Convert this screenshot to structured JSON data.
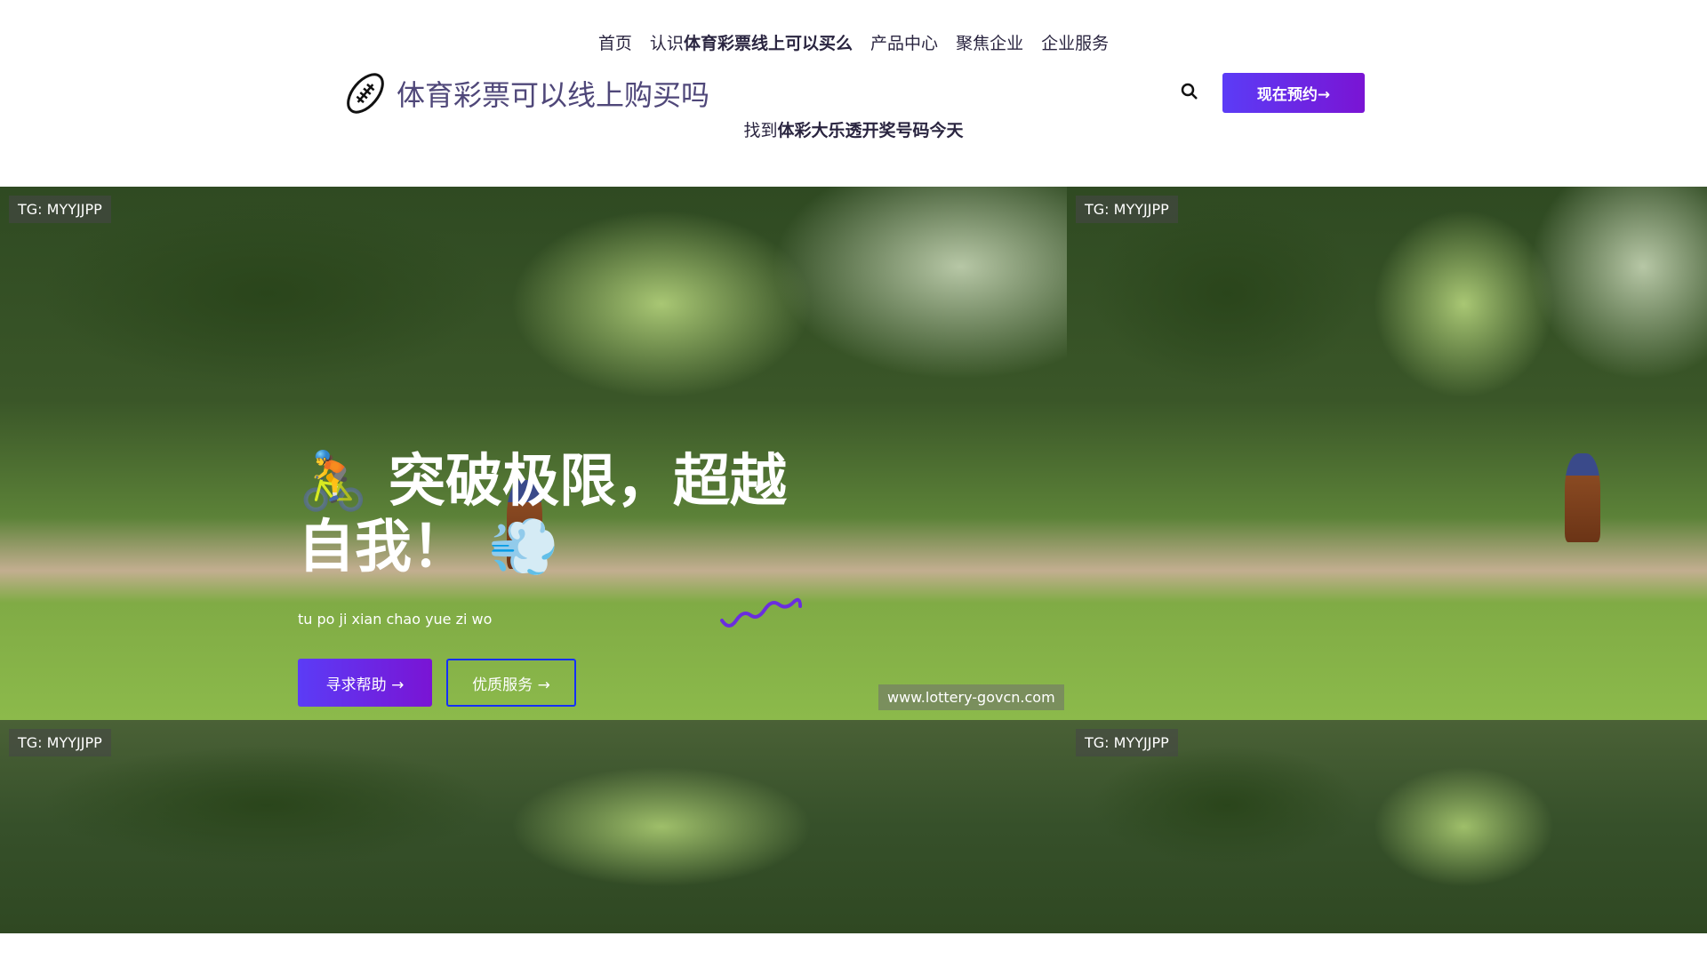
{
  "nav": {
    "items": [
      {
        "label": "首页"
      },
      {
        "label_prefix": "认识",
        "label_bold": "体育彩票线上可以买么"
      },
      {
        "label": "产品中心"
      },
      {
        "label": "聚焦企业"
      },
      {
        "label": "企业服务"
      }
    ]
  },
  "header": {
    "site_title": "体育彩票可以线上购买吗",
    "logo_icon": "football-icon",
    "search_icon": "search-icon",
    "cta_label": "现在预约→",
    "subtitle_prefix": "找到",
    "subtitle_bold": "体彩大乐透开奖号码今天"
  },
  "hero": {
    "title_emoji_start": "🚴",
    "title": "突破极限，超越自我！",
    "title_emoji_end": "💨",
    "subtitle": "tu po ji xian chao yue zi wo",
    "primary_button": "寻求帮助 →",
    "secondary_button": "优质服务 →",
    "watermark": "www.lottery-govcn.com"
  },
  "tiles": [
    {
      "tag": "TG: MYYJJPP"
    },
    {
      "tag": "TG: MYYJJPP"
    },
    {
      "tag": "TG: MYYJJPP"
    },
    {
      "tag": "TG: MYYJJPP"
    }
  ],
  "colors": {
    "accent_start": "#5b3cf6",
    "accent_end": "#7a14d4",
    "outline_button": "#1430ff"
  }
}
